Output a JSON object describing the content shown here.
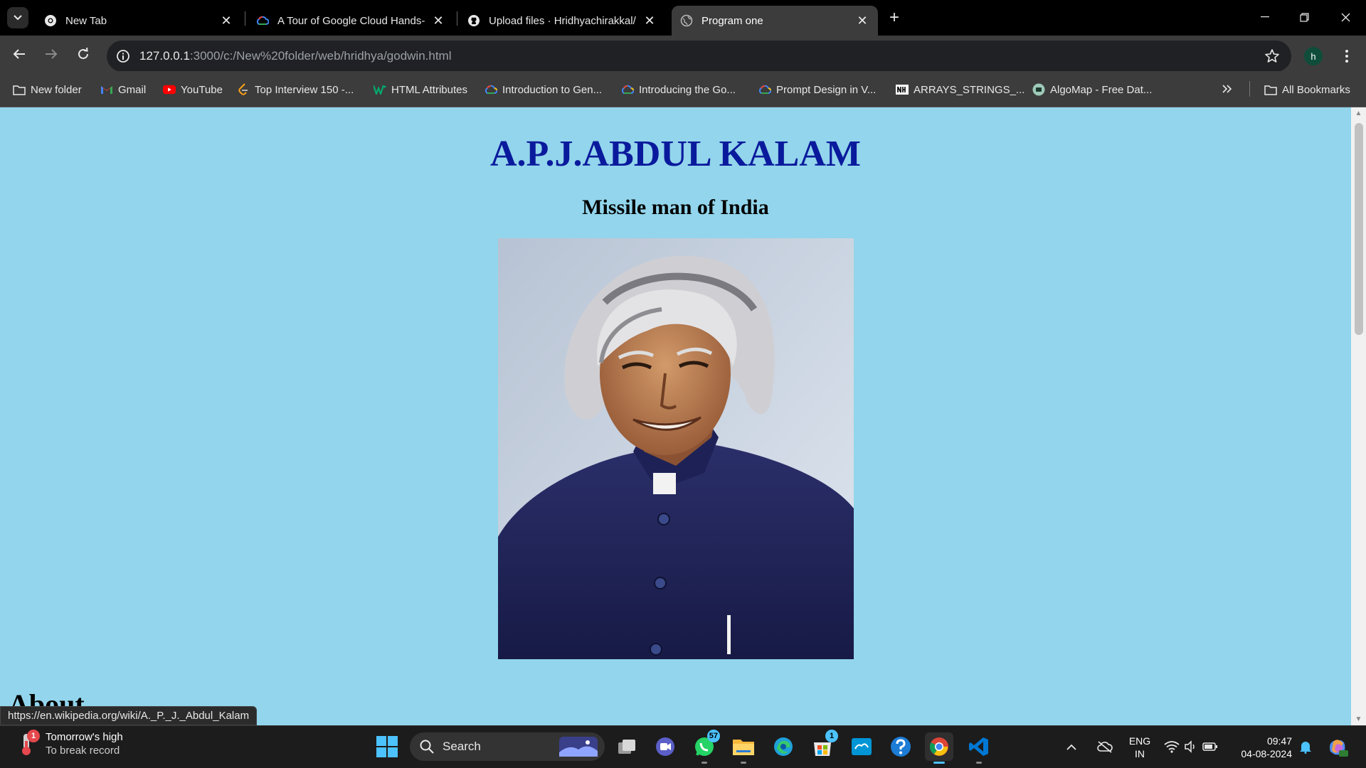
{
  "browser": {
    "tabs": [
      {
        "title": "New Tab",
        "icon": "chrome-icon",
        "active": false
      },
      {
        "title": "A Tour of Google Cloud Hands-",
        "icon": "google-cloud-icon",
        "active": false
      },
      {
        "title": "Upload files · Hridhyachirakkal/",
        "icon": "github-icon",
        "active": false
      },
      {
        "title": "Program one",
        "icon": "globe-icon",
        "active": true
      }
    ],
    "url_host": "127.0.0.1",
    "url_rest": ":3000/c:/New%20folder/web/hridhya/godwin.html",
    "profile_initial": "h",
    "bookmarks": [
      {
        "label": "New folder",
        "icon": "folder-icon"
      },
      {
        "label": "Gmail",
        "icon": "gmail-icon"
      },
      {
        "label": "YouTube",
        "icon": "youtube-icon"
      },
      {
        "label": "Top Interview 150 -...",
        "icon": "leetcode-icon"
      },
      {
        "label": "HTML Attributes",
        "icon": "w3schools-icon"
      },
      {
        "label": "Introduction to Gen...",
        "icon": "google-cloud-icon"
      },
      {
        "label": "Introducing the Go...",
        "icon": "google-cloud-icon"
      },
      {
        "label": "Prompt Design in V...",
        "icon": "google-cloud-icon"
      },
      {
        "label": "ARRAYS_STRINGS_...",
        "icon": "notion-icon"
      },
      {
        "label": "AlgoMap - Free Dat...",
        "icon": "algomap-icon"
      }
    ],
    "all_bookmarks": "All Bookmarks",
    "status_url": "https://en.wikipedia.org/wiki/A._P._J._Abdul_Kalam"
  },
  "page": {
    "title": "A.P.J.ABDUL KALAM",
    "subtitle": "Missile man of India",
    "about_heading": "About"
  },
  "taskbar": {
    "weather_line1": "Tomorrow's high",
    "weather_line2": "To break record",
    "weather_badge": "1",
    "search_label": "Search",
    "whatsapp_badge": "57",
    "store_badge": "1",
    "lang_line1": "ENG",
    "lang_line2": "IN",
    "time": "09:47",
    "date": "04-08-2024"
  },
  "colors": {
    "page_bg": "#92d5ec",
    "title_color": "#0a1a9c",
    "accent": "#4cc2ff"
  }
}
